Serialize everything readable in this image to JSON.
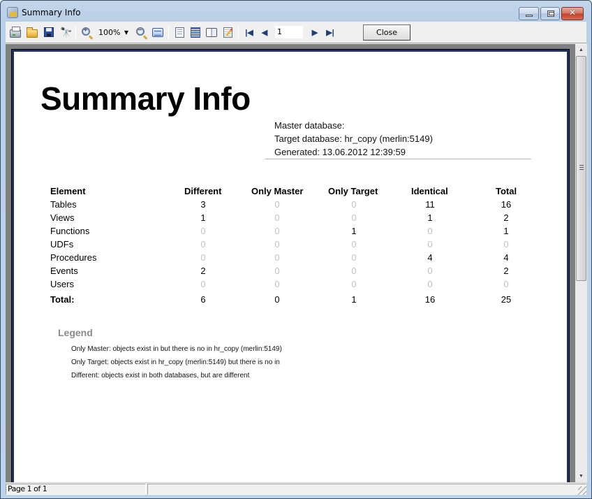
{
  "window": {
    "title": "Summary Info",
    "icon": "app-scales-icon",
    "controls": {
      "minimize": "minimize-icon",
      "maximize": "maximize-icon",
      "close": "close-x-icon",
      "close_glyph": "✕"
    }
  },
  "toolbar": {
    "icons": [
      "print-icon",
      "open-icon",
      "save-icon",
      "find-icon",
      "zoom-in-icon",
      "zoom-out-icon",
      "page-width-icon",
      "single-page-icon",
      "multi-page-icon",
      "book-icon",
      "edit-icon",
      "first-page-icon",
      "prev-page-icon",
      "next-page-icon",
      "last-page-icon"
    ],
    "zoom_value": "100%",
    "page_value": "1",
    "close_label": "Close",
    "find_glyph": "🔭",
    "first_glyph": "|◀",
    "prev_glyph": "◀",
    "next_glyph": "▶",
    "last_glyph": "▶|",
    "caret_glyph": "▼",
    "zoom_in_glyph": "+",
    "zoom_out_glyph": "−"
  },
  "report": {
    "title": "Summary Info",
    "master_database": "Master database:",
    "target_database": "Target database: hr_copy (merlin:5149)",
    "generated": "Generated: 13.06.2012 12:39:59",
    "table": {
      "columns": [
        "Element",
        "Different",
        "Only Master",
        "Only Target",
        "Identical",
        "Total"
      ],
      "rows": [
        {
          "element": "Tables",
          "values": [
            "3",
            "0",
            "0",
            "11",
            "16"
          ]
        },
        {
          "element": "Views",
          "values": [
            "1",
            "0",
            "0",
            "1",
            "2"
          ]
        },
        {
          "element": "Functions",
          "values": [
            "0",
            "0",
            "1",
            "0",
            "1"
          ]
        },
        {
          "element": "UDFs",
          "values": [
            "0",
            "0",
            "0",
            "0",
            "0"
          ]
        },
        {
          "element": "Procedures",
          "values": [
            "0",
            "0",
            "0",
            "4",
            "4"
          ]
        },
        {
          "element": "Events",
          "values": [
            "2",
            "0",
            "0",
            "0",
            "2"
          ]
        },
        {
          "element": "Users",
          "values": [
            "0",
            "0",
            "0",
            "0",
            "0"
          ]
        }
      ],
      "total": {
        "label": "Total:",
        "values": [
          "6",
          "0",
          "1",
          "16",
          "25"
        ]
      }
    },
    "legend": {
      "title": "Legend",
      "lines": [
        "Only Master: objects exist in  but there is no in hr_copy (merlin:5149)",
        "Only Target: objects exist in hr_copy (merlin:5149) but there is no in",
        "Different:  objects exist in both databases, but are different"
      ]
    }
  },
  "scrollbar": {
    "up_glyph": "▲",
    "down_glyph": "▼"
  },
  "status": {
    "page_info": "Page 1 of 1",
    "secondary": ""
  }
}
